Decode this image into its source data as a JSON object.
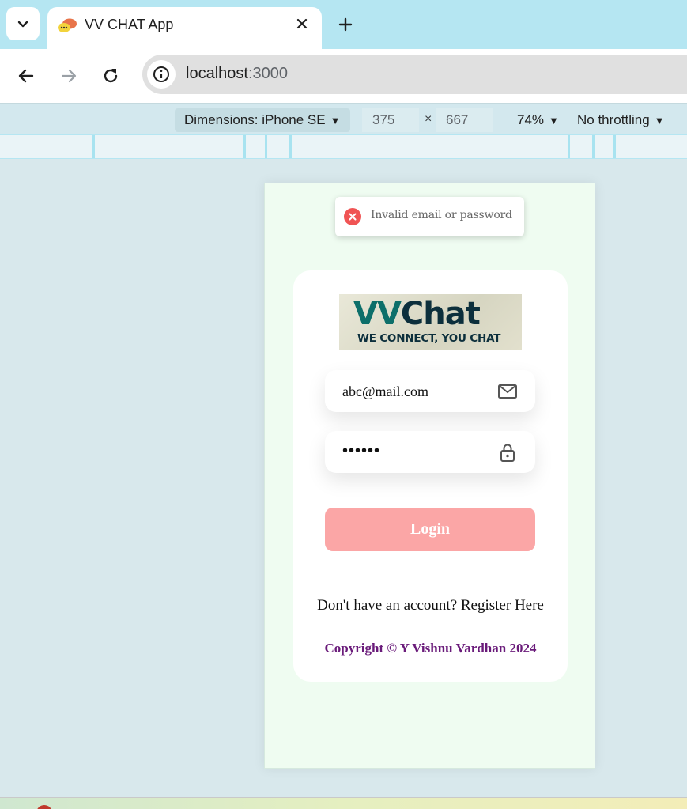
{
  "browser": {
    "tab_title": "VV CHAT App",
    "url_host": "localhost",
    "url_port": ":3000"
  },
  "devtools": {
    "dimensions_label": "Dimensions: iPhone SE",
    "width": "375",
    "times": "×",
    "height": "667",
    "zoom": "74%",
    "throttling": "No throttling"
  },
  "page": {
    "toast_message": "Invalid email or password",
    "logo_main_vv": "VV",
    "logo_main_chat": "Chat",
    "logo_tagline": "WE CONNECT, YOU CHAT",
    "email_value": "abc@mail.com",
    "password_value": "••••••",
    "login_label": "Login",
    "register_text": "Don't have an account? Register Here",
    "copyright": "Copyright © Y Vishnu Vardhan 2024"
  },
  "colors": {
    "tabstrip": "#b5e6f2",
    "login_button": "#fba6a6",
    "toast_error": "#f05454",
    "copyright": "#6a1b7a"
  }
}
